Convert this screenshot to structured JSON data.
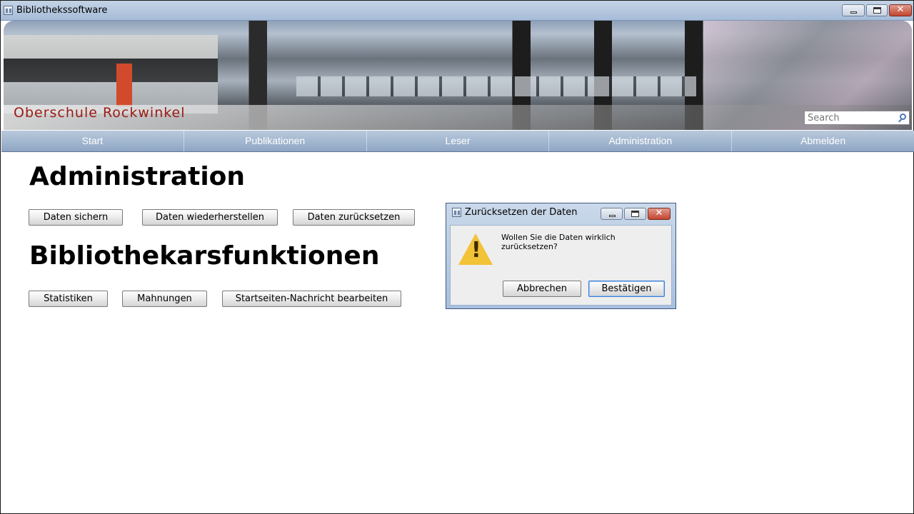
{
  "window": {
    "title": "Bibliothekssoftware",
    "controls": {
      "minimize": "",
      "maximize": "",
      "close": "✕"
    }
  },
  "banner": {
    "school_name": "Oberschule Rockwinkel",
    "search": {
      "placeholder": "Search",
      "value": ""
    }
  },
  "nav": {
    "items": [
      "Start",
      "Publikationen",
      "Leser",
      "Administration",
      "Abmelden"
    ]
  },
  "main": {
    "admin_heading": "Administration",
    "admin_buttons": [
      "Daten sichern",
      "Daten wiederherstellen",
      "Daten zurücksetzen"
    ],
    "library_heading": "Bibliothekarsfunktionen",
    "library_buttons": [
      "Statistiken",
      "Mahnungen",
      "Startseiten-Nachricht bearbeiten"
    ]
  },
  "dialog": {
    "title": "Zurücksetzen der Daten",
    "message": "Wollen Sie die Daten wirklich zurücksetzen?",
    "cancel_label": "Abbrechen",
    "confirm_label": "Bestätigen",
    "close_glyph": "✕",
    "warning_glyph": "!"
  },
  "colors": {
    "nav_bar": "#9fb4cf",
    "school_name": "#9a1b12",
    "close_button": "#c3452f",
    "warning": "#f2c237"
  },
  "icons": [
    "app-icon",
    "minimize-icon",
    "maximize-icon",
    "close-icon",
    "search-icon",
    "warning-icon"
  ]
}
